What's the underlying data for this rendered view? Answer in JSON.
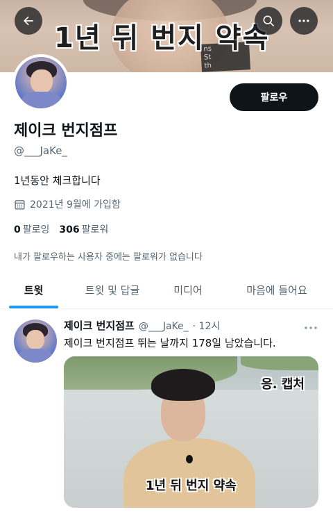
{
  "banner": {
    "caption": "1년 뒤 번지 약속",
    "shirt_text": "ns\nSt\nth"
  },
  "profile": {
    "name": "제이크 번지점프",
    "handle": "@___JaKe_",
    "bio": "1년동안 체크합니다",
    "joined": "2021년 9월에 가입함",
    "following_count": "0",
    "following_label": "팔로잉",
    "followers_count": "306",
    "followers_label": "팔로워",
    "followers_note": "내가 팔로우하는 사용자 중에는 팔로워가 없습니다",
    "follow_button": "팔로우"
  },
  "tabs": [
    {
      "label": "트윗",
      "active": true
    },
    {
      "label": "트윗 및 답글",
      "active": false
    },
    {
      "label": "미디어",
      "active": false
    },
    {
      "label": "마음에 들어요",
      "active": false
    }
  ],
  "tweet": {
    "author": "제이크 번지점프",
    "handle": "@___JaKe_",
    "time": "· 12시",
    "text": "제이크 번지점프 뛰는 날까지 178일 남았습니다.",
    "media_caption_top": "응. 캡처",
    "media_caption_bottom": "1년 뒤 번지 약속"
  },
  "icons": {
    "back": "arrow-left-icon",
    "search": "search-icon",
    "more": "more-horizontal-icon",
    "calendar": "calendar-icon"
  },
  "colors": {
    "accent": "#1d9bf0",
    "text": "#0f1419",
    "muted": "#536471"
  }
}
